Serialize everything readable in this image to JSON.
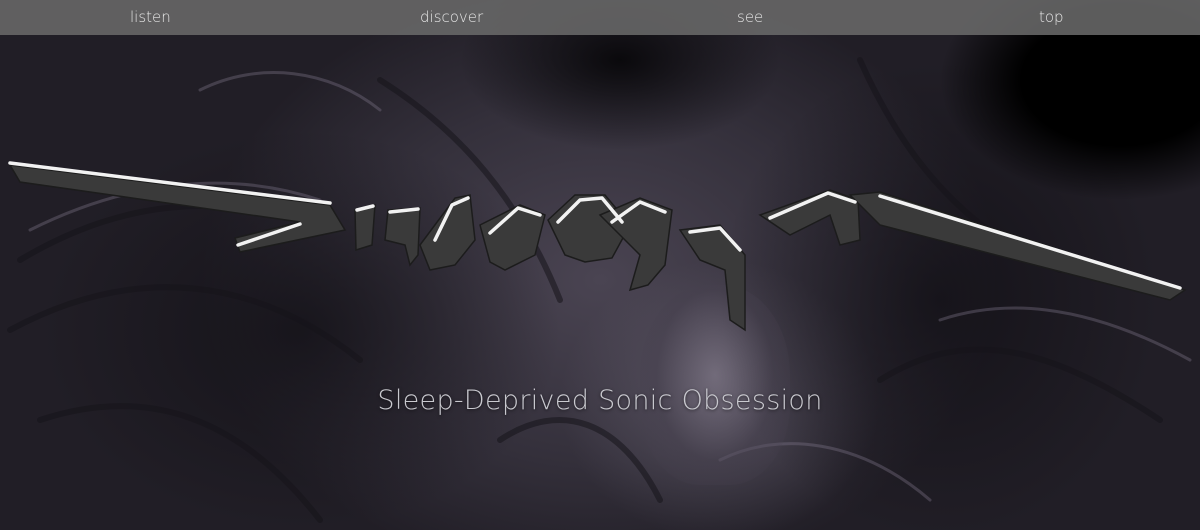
{
  "nav": {
    "listen": "listen",
    "discover": "discover",
    "see": "see",
    "top": "top"
  },
  "hero": {
    "logo_alt": "Dialogue",
    "tagline": "Sleep-Deprived Sonic Obsession"
  },
  "colors": {
    "nav_bg": "#696969",
    "nav_text": "#e6e6e6",
    "hero_tint": "#4a4452",
    "logo_fill": "#3a3a3a",
    "logo_highlight": "#f2f2f2",
    "tagline_text": "#c9c9cf"
  }
}
